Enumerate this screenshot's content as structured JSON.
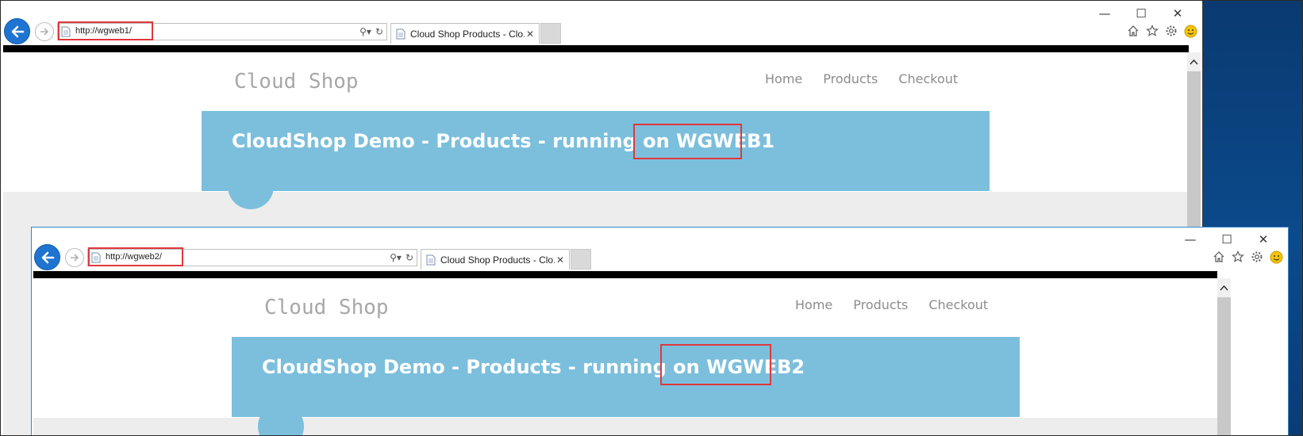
{
  "window1": {
    "address": "http://wgweb1/",
    "tab_title": "Cloud Shop Products - Clo...",
    "logo": "Cloud Shop",
    "nav": [
      "Home",
      "Products",
      "Checkout"
    ],
    "hero_prefix": "CloudShop Demo - Products - running on",
    "host": "WGWEB1"
  },
  "window2": {
    "address": "http://wgweb2/",
    "tab_title": "Cloud Shop Products - Clo...",
    "logo": "Cloud Shop",
    "nav": [
      "Home",
      "Products",
      "Checkout"
    ],
    "hero_prefix": "CloudShop Demo - Products - running on",
    "host": "WGWEB2"
  },
  "icons": {
    "back": "back-arrow-icon",
    "forward": "forward-arrow-icon",
    "search": "search-icon",
    "refresh": "refresh-icon",
    "home": "home-icon",
    "favorites": "star-icon",
    "settings": "gear-icon",
    "feedback": "smiley-icon"
  },
  "colors": {
    "hero": "#7cbfdc",
    "highlight": "#e0373c",
    "nav_text": "#8c8c8c",
    "logo_text": "#a8a8a8",
    "back_button": "#1e74d0"
  }
}
